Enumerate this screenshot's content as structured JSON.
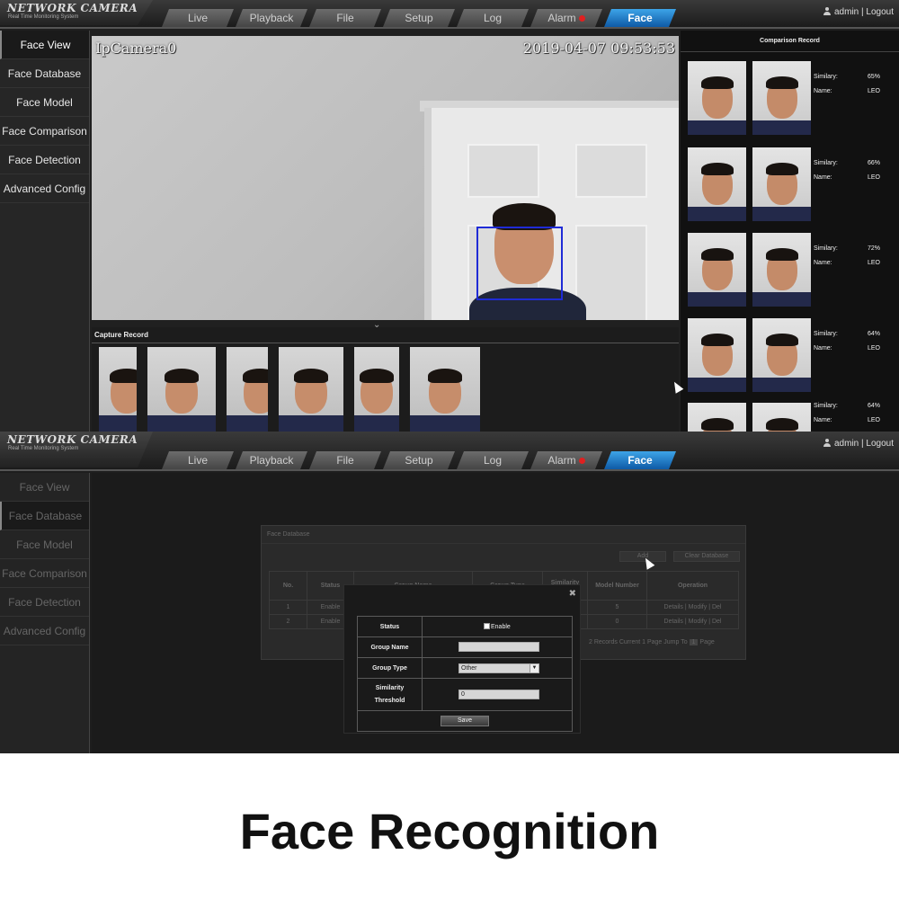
{
  "top": {
    "logo": "NETWORK CAMERA",
    "logo_sub": "Real Time Monitoring System",
    "tabs": [
      {
        "label": "Live"
      },
      {
        "label": "Playback"
      },
      {
        "label": "File"
      },
      {
        "label": "Setup"
      },
      {
        "label": "Log"
      },
      {
        "label": "Alarm"
      },
      {
        "label": "Face"
      }
    ],
    "user": "admin",
    "user_sep": "|",
    "logout": "Logout",
    "sidebar": [
      {
        "label": "Face View"
      },
      {
        "label": "Face Database"
      },
      {
        "label": "Face Model"
      },
      {
        "label": "Face Comparison"
      },
      {
        "label": "Face Detection"
      },
      {
        "label": "Advanced Config"
      }
    ],
    "video": {
      "camera_name": "IpCamera0",
      "timestamp": "2019-04-07 09:53:53"
    },
    "capture_title": "Capture Record",
    "comparison_title": "Comparison Record",
    "comparison": [
      {
        "similarity_label": "Similary:",
        "similarity": "65%",
        "name_label": "Name:",
        "name": "LEO"
      },
      {
        "similarity_label": "Similary:",
        "similarity": "66%",
        "name_label": "Name:",
        "name": "LEO"
      },
      {
        "similarity_label": "Similary:",
        "similarity": "72%",
        "name_label": "Name:",
        "name": "LEO"
      },
      {
        "similarity_label": "Similary:",
        "similarity": "64%",
        "name_label": "Name:",
        "name": "LEO"
      },
      {
        "similarity_label": "Similary:",
        "similarity": "64%",
        "name_label": "Name:",
        "name": "LEO"
      }
    ]
  },
  "bottom": {
    "logo": "NETWORK CAMERA",
    "logo_sub": "Real Time Monitoring System",
    "tabs": [
      {
        "label": "Live"
      },
      {
        "label": "Playback"
      },
      {
        "label": "File"
      },
      {
        "label": "Setup"
      },
      {
        "label": "Log"
      },
      {
        "label": "Alarm"
      },
      {
        "label": "Face"
      }
    ],
    "user": "admin",
    "user_sep": "|",
    "logout": "Logout",
    "sidebar": [
      {
        "label": "Face View"
      },
      {
        "label": "Face Database"
      },
      {
        "label": "Face Model"
      },
      {
        "label": "Face Comparison"
      },
      {
        "label": "Face Detection"
      },
      {
        "label": "Advanced Config"
      }
    ],
    "database": {
      "title": "Face Database",
      "add_button": "Add",
      "clear_button": "Clear Database",
      "columns": [
        "No.",
        "Status",
        "Group Name",
        "Group Type",
        "Similarity Threshold",
        "Model Number",
        "Operation"
      ],
      "rows": [
        {
          "no": "1",
          "status": "Enable",
          "model_number": "5",
          "operation": "Details | Modify | Del"
        },
        {
          "no": "2",
          "status": "Enable",
          "model_number": "0",
          "operation": "Details | Modify | Del"
        }
      ],
      "footer": "2 Records  Current  1 Page  Jump To",
      "page_select": "1",
      "page_suffix": "Page"
    },
    "modal": {
      "status_label": "Status",
      "enable_label": "Enable",
      "group_name_label": "Group Name",
      "group_name_value": "",
      "group_type_label": "Group Type",
      "group_type_value": "Other",
      "similarity_label_1": "Similarity",
      "similarity_label_2": "Threshold",
      "similarity_value": "0",
      "save_label": "Save"
    }
  },
  "caption": "Face Recognition",
  "colors": {
    "active_tab": "#1b7fd0",
    "face_box": "#1f2bd6",
    "alarm_dot": "#e02020"
  }
}
